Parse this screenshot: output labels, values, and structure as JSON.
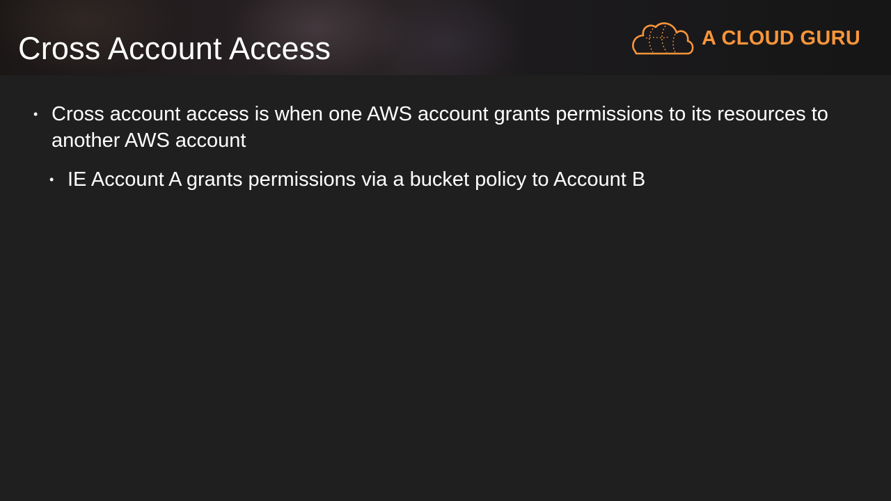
{
  "slide": {
    "title": "Cross Account Access",
    "logo_text": "A CLOUD GURU",
    "brand_color": "#f7953b",
    "bullets": [
      {
        "level": 1,
        "text": "Cross account access is when one AWS account grants permissions to its resources to another AWS account"
      },
      {
        "level": 2,
        "text": "IE Account A grants permissions via a bucket policy to Account B"
      }
    ]
  }
}
